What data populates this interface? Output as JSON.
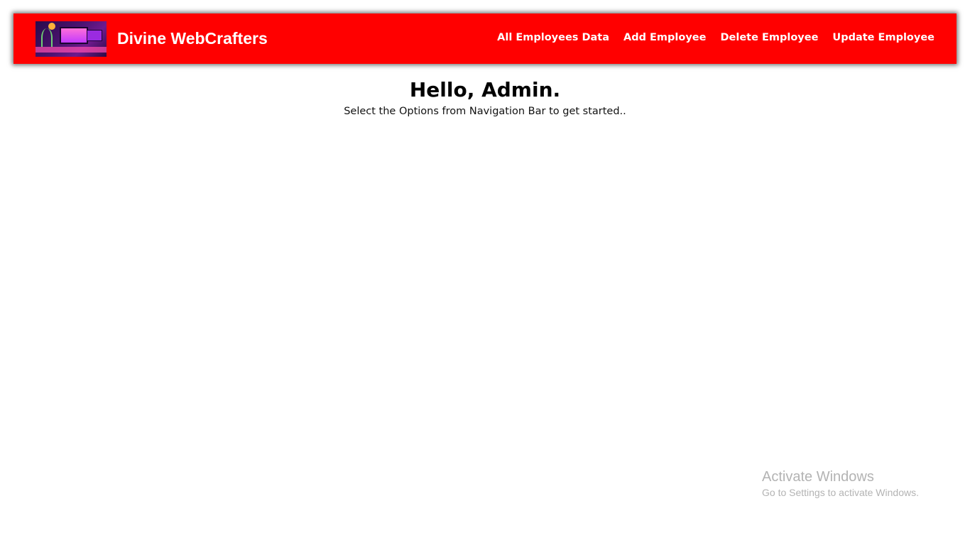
{
  "navbar": {
    "logo_alt": "Divine WebCrafters logo",
    "brand": "Divine WebCrafters",
    "links": [
      {
        "label": "All Employees Data"
      },
      {
        "label": "Add Employee"
      },
      {
        "label": "Delete Employee"
      },
      {
        "label": "Update Employee"
      }
    ],
    "background_color": "#ff0000"
  },
  "main": {
    "greeting": "Hello, Admin.",
    "subtitle": "Select the Options from Navigation Bar to get started.."
  },
  "watermark": {
    "title": "Activate Windows",
    "subtitle": "Go to Settings to activate Windows."
  }
}
